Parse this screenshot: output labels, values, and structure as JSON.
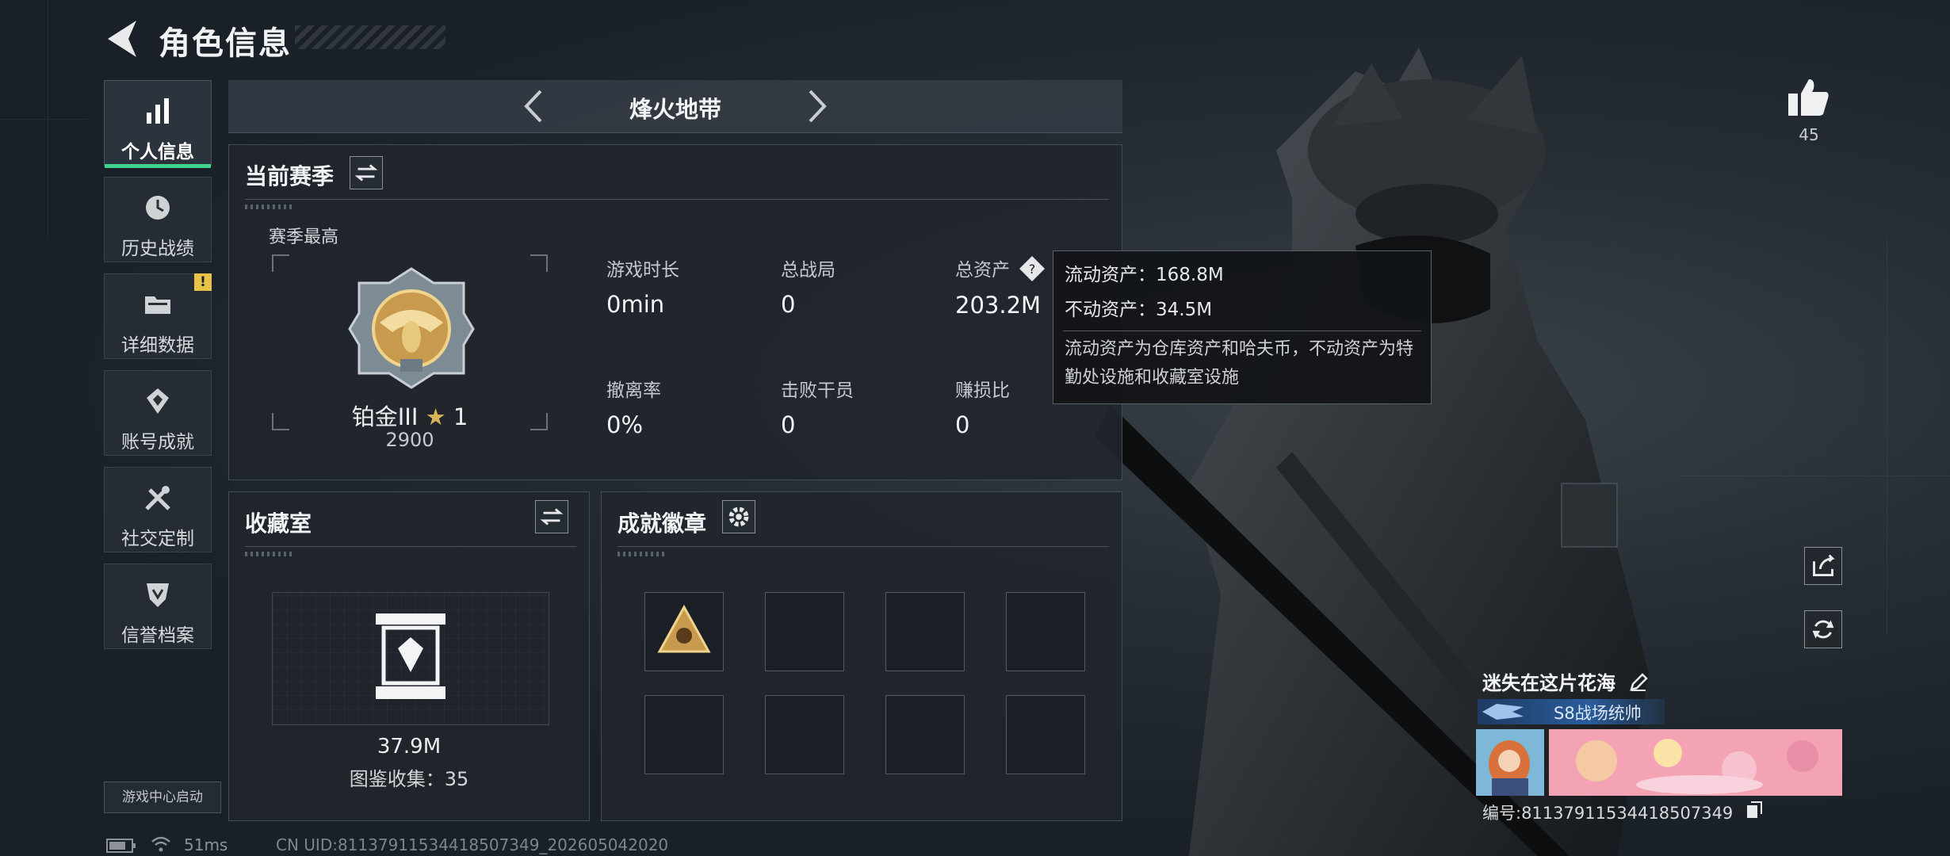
{
  "header": {
    "title": "角色信息"
  },
  "nav": {
    "items": [
      {
        "label": "个人信息",
        "active": true
      },
      {
        "label": "历史战绩"
      },
      {
        "label": "详细数据",
        "badge": "!"
      },
      {
        "label": "账号成就"
      },
      {
        "label": "社交定制"
      },
      {
        "label": "信誉档案"
      }
    ],
    "launch_label": "游戏中心启动"
  },
  "mode": {
    "name": "烽火地带"
  },
  "season": {
    "title": "当前赛季",
    "best_label": "赛季最高",
    "rank_name": "铂金III",
    "rank_stars": "1",
    "rank_score": "2900",
    "stats": [
      {
        "label": "游戏时长",
        "value": "0min"
      },
      {
        "label": "总战局",
        "value": "0"
      },
      {
        "label": "总资产",
        "value": "203.2M"
      },
      {
        "label": "撤离率",
        "value": "0%"
      },
      {
        "label": "击败干员",
        "value": "0"
      },
      {
        "label": "赚损比",
        "value": "0"
      }
    ]
  },
  "tooltip": {
    "liquid": "流动资产：168.8M",
    "fixed": "不动资产：34.5M",
    "description": "流动资产为仓库资产和哈夫币，不动资产为特勤处设施和收藏室设施"
  },
  "collection": {
    "title": "收藏室",
    "value": "37.9M",
    "catalog": "图鉴收集：35"
  },
  "achievements": {
    "title": "成就徽章"
  },
  "player": {
    "likes": "45",
    "name": "迷失在这片花海",
    "title": "S8战场统帅",
    "uid_line": "编号:81137911534418507349"
  },
  "status": {
    "ping": "51ms",
    "cn_uid": "CN UID:81137911534418507349_202605042020"
  },
  "colors": {
    "accent": "#3fd38c",
    "badge": "#e8c34a",
    "gold": "#c79a4e"
  }
}
